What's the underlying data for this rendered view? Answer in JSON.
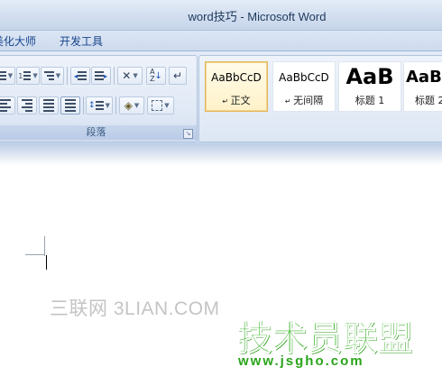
{
  "window": {
    "title": "word技巧 - Microsoft Word"
  },
  "tabs": [
    {
      "label": "美化大师"
    },
    {
      "label": "开发工具"
    }
  ],
  "ribbon": {
    "paragraph_group": {
      "label": "段落"
    },
    "styles": [
      {
        "preview": "AaBbCcD",
        "name": "正文",
        "selected": true
      },
      {
        "preview": "AaBbCcD",
        "name": "无间隔",
        "selected": false
      },
      {
        "preview": "AaB",
        "name": "标题 1",
        "selected": false
      },
      {
        "preview": "AaBb",
        "name": "标题 2",
        "selected": false
      }
    ]
  },
  "watermarks": {
    "top": "三联网 3LIAN.COM",
    "brand": "技术员联盟",
    "url": "www.jsgho.com"
  },
  "colors": {
    "ribbon": "#d6e2f3",
    "selected_style": "#fff2c8",
    "brand_green": "#32b21f"
  }
}
